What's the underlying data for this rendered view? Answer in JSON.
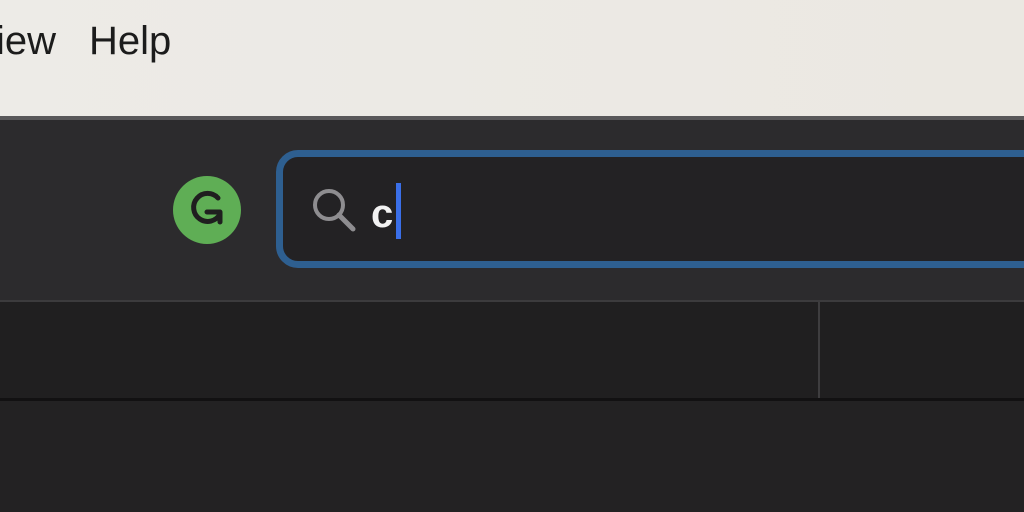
{
  "menubar": {
    "items": [
      {
        "label": "View"
      },
      {
        "label": "Help"
      }
    ]
  },
  "toolbar": {
    "grammarly_icon": "grammarly-g-icon",
    "search": {
      "icon": "search-icon",
      "value": "c",
      "accent_color": "#2e5f90",
      "caret_color": "#3a6fe8"
    }
  },
  "colors": {
    "menubar_bg": "#edebe7",
    "toolbar_bg": "#2c2b2d",
    "grammarly_green": "#5fae55"
  }
}
